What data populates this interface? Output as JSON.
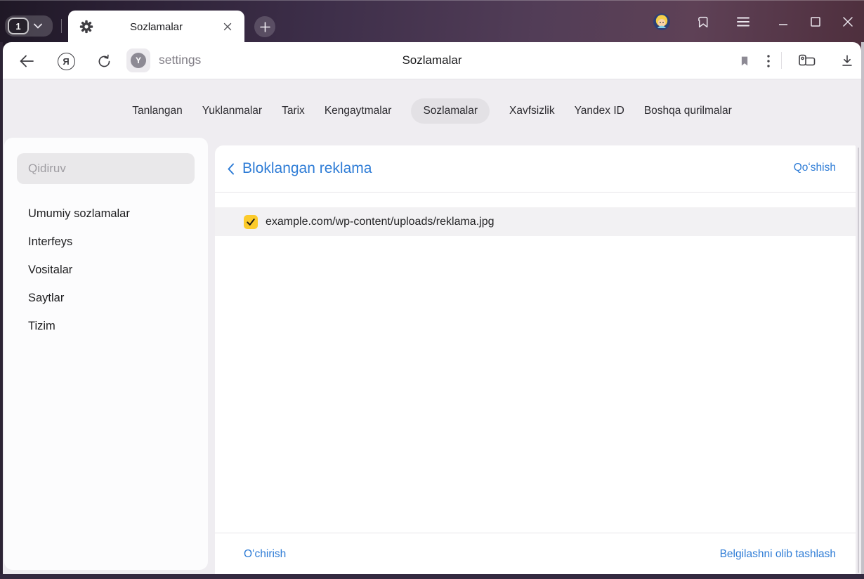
{
  "chrome": {
    "tab_counter": "1",
    "tab": {
      "title": "Sozlamalar"
    }
  },
  "toolbar": {
    "address_value": "settings",
    "page_title": "Sozlamalar"
  },
  "icons": {
    "yandex_logo_glyph": "Я",
    "y_badge_glyph": "Y"
  },
  "nav_tabs": {
    "items": [
      {
        "label": "Tanlangan",
        "active": false
      },
      {
        "label": "Yuklanmalar",
        "active": false
      },
      {
        "label": "Tarix",
        "active": false
      },
      {
        "label": "Kengaytmalar",
        "active": false
      },
      {
        "label": "Sozlamalar",
        "active": true
      },
      {
        "label": "Xavfsizlik",
        "active": false
      },
      {
        "label": "Yandex ID",
        "active": false
      },
      {
        "label": "Boshqa qurilmalar",
        "active": false
      }
    ]
  },
  "sidebar": {
    "search_placeholder": "Qidiruv",
    "items": [
      {
        "label": "Umumiy sozlamalar"
      },
      {
        "label": "Interfeys"
      },
      {
        "label": "Vositalar"
      },
      {
        "label": "Saytlar"
      },
      {
        "label": "Tizim"
      }
    ]
  },
  "content": {
    "header": {
      "back_label": "Bloklangan reklama",
      "add_link": "Qoʻshish"
    },
    "list": [
      {
        "url": "example.com/wp-content/uploads/reklama.jpg",
        "checked": true
      }
    ],
    "footer": {
      "delete_link": "Oʻchirish",
      "clear_selection_link": "Belgilashni olib tashlash"
    }
  },
  "colors": {
    "link_blue": "#2e7cd6",
    "checkbox_yellow": "#fccb2b",
    "chrome_dark": "#2d2435"
  }
}
